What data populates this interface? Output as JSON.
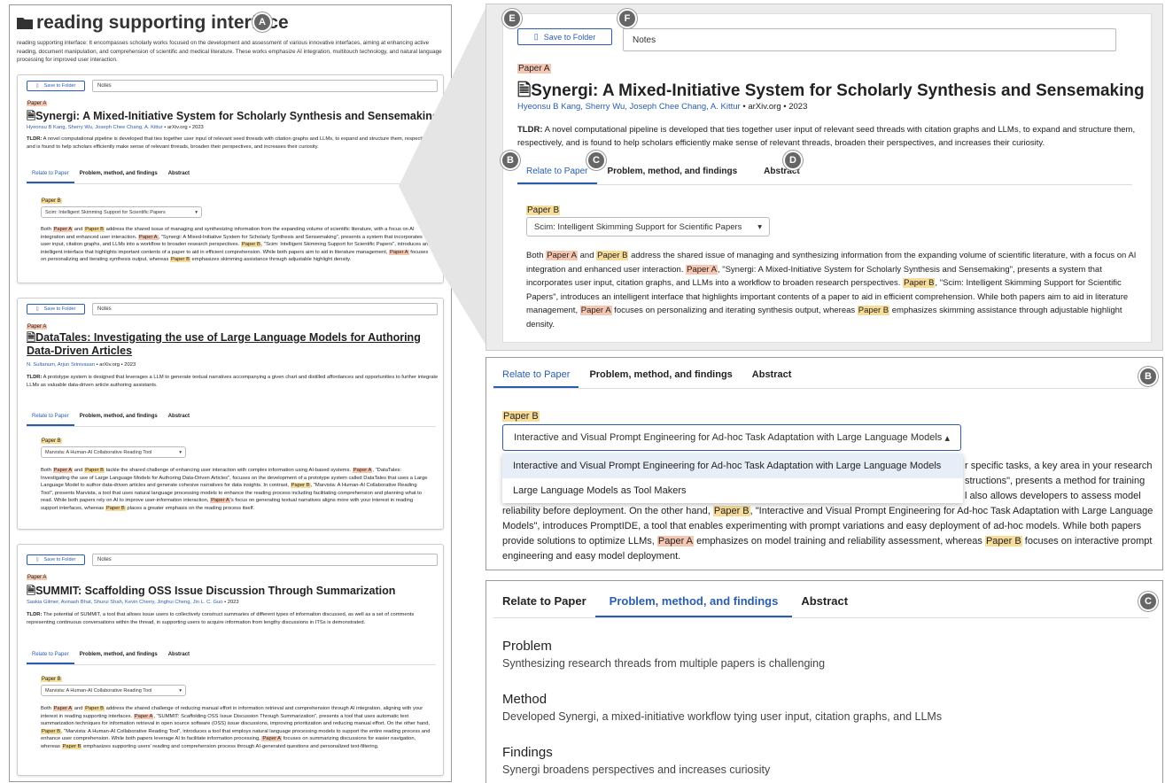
{
  "left": {
    "title": "reading supporting interface",
    "description": "reading supporting interface: It encompasses scholarly works focused on the development and assessment of various innovative interfaces, aiming at enhancing active reading, document manipulation, and comprehension of scientific and medical literature. These works emphasize AI integration, multitouch technology, and natural language processing for improved user interaction.",
    "save_label": "Save to Folder",
    "notes_label": "Notes",
    "paper_a_tag": "Paper A",
    "paper_b_tag": "Paper B",
    "tabs": [
      "Relate to Paper",
      "Problem, method, and findings",
      "Abstract"
    ],
    "cards": [
      {
        "title": "Synergi: A Mixed-Initiative System for Scholarly Synthesis and Sensemaking",
        "authors": "Hyeonsu B Kang, Sherry Wu, Joseph Chee Chang, A. Kittur",
        "venue": " • arXiv.org • 2023",
        "tldr_label": "TLDR:",
        "tldr": " A novel computational pipeline is developed that ties together user input of relevant seed threads with citation graphs and LLMs, to expand and structure them, respectively, and is found to help scholars efficiently make sense of relevant threads, broaden their perspectives, and increases their curiosity.",
        "select": "Scim: Intelligent Skimming Support for Scientific Papers"
      },
      {
        "title": "DataTales: Investigating the use of Large Language Models for Authoring Data-Driven Articles",
        "authors": "N. Sultanum, Arjun Srinivasan",
        "venue": " • arXiv.org • 2023",
        "tldr_label": "TLDR:",
        "tldr": " A prototype system is designed that leverages a LLM to generate textual narratives accompanying a given chart and distilled affordances and opportunities to further integrate LLMs as valuable data-driven article authoring assistants.",
        "select": "Marvista: A Human-AI Collaborative Reading Tool"
      },
      {
        "title": "SUMMIT: Scaffolding OSS Issue Discussion Through Summarization",
        "authors": "Saskia Gilmer, Avinash Bhat, Shurui Shah, Kevin Cherry, Jinghui Cheng, Jin L. C. Guo",
        "venue": " • 2023",
        "tldr_label": "TLDR:",
        "tldr": " The potential of SUMMIT, a tool that allows issue users to collectively construct summaries of different types of information discussed, as well as a set of comments representing continuous conversations within the thread, in supporting users to acquire information from lengthy discussions in ITSs is demonstrated.",
        "select": "Marvista: A Human-AI Collaborative Reading Tool"
      }
    ],
    "card1_relation": {
      "p1": "Both ",
      "p2": " and ",
      "p3": " address the shared issue of managing and synthesizing information from the expanding volume of scientific literature, with a focus on AI integration and enhanced user interaction. ",
      "p4": ", \"Synergi: A Mixed-Initiative System for Scholarly Synthesis and Sensemaking\", presents a system that incorporates user input, citation graphs, and LLMs into a workflow to broaden research perspectives. ",
      "p5": ", \"Scim: Intelligent Skimming Support for Scientific Papers\", introduces an intelligent interface that highlights important contents of a paper to aid in efficient comprehension. While both papers aim to aid in literature management, ",
      "p6": " focuses on personalizing and iterating synthesis output, whereas ",
      "p7": " emphasizes skimming assistance through adjustable highlight density."
    },
    "card2_relation": {
      "p1": "Both ",
      "p2": " and ",
      "p3": " tackle the shared challenge of enhancing user interaction with complex information using AI-based systems. ",
      "p4": ", \"DataTales: Investigating the use of Large Language Models for Authoring Data-Driven Articles\", focuses on the development of a prototype system called DataTales that uses a Large Language Model to author data-driven articles and generate cohesive narratives for data insights. In contrast, ",
      "p5": ", \"Marvista: A Human-AI Collaborative Reading Tool\", presents Marvista, a tool that uses natural language processing models to enhance the reading process including facilitating comprehension and planning what to read. While both papers rely on AI to improve user-information interaction, ",
      "p6": "'s focus on generating textual narratives aligns more with your interest in reading support interfaces, whereas ",
      "p7": " places a greater emphasis on the reading process itself."
    },
    "card3_relation": {
      "p1": "Both ",
      "p2": " and ",
      "p3": " address the shared challenge of reducing manual effort in information retrieval and comprehension through AI integration, aligning with your interest in reading supporting interfaces. ",
      "p4": ", \"SUMMIT: Scaffolding OSS Issue Discussion Through Summarization\", presents a tool that uses automatic text summarization techniques for information retrieval in open source software (OSS) issue discussions, improving prioritization and reducing manual effort. On the other hand, ",
      "p5": ", \"Marvista: A Human-AI Collaborative Reading Tool\", introduces a tool that employs natural language processing models to support the entire reading process and enhance user comprehension. While both papers leverage AI to facilitate information processing, ",
      "p6": " focuses on summarizing discussions for easier navigation, whereas ",
      "p7": " emphasizes supporting users' reading and comprehension process through AI-generated questions and personalized text-filtering."
    }
  },
  "zoom": {
    "save_label": "Save to Folder",
    "notes_label": "Notes",
    "paper_a_tag": "Paper A",
    "paper_b_tag": "Paper B",
    "title": "Synergi: A Mixed-Initiative System for Scholarly Synthesis and Sensemaking",
    "authors": "Hyeonsu B Kang, Sherry Wu, Joseph Chee Chang, A. Kittur",
    "venue": " • arXiv.org • 2023",
    "tldr_label": "TLDR:",
    "tldr": " A novel computational pipeline is developed that ties together user input of relevant seed threads with citation graphs and LLMs, to expand and structure them, respectively, and is found to help scholars efficiently make sense of relevant threads, broaden their perspectives, and increases their curiosity.",
    "tabs": [
      "Relate to Paper",
      "Problem, method, and findings",
      "Abstract"
    ],
    "select": "Scim: Intelligent Skimming Support for Scientific Papers"
  },
  "panelB": {
    "tabs": [
      "Relate to Paper",
      "Problem, method, and findings",
      "Abstract"
    ],
    "paper_b_tag": "Paper B",
    "select": "Interactive and Visual Prompt Engineering for Ad-hoc Task Adaptation with Large Language Models",
    "options": [
      "Interactive and Visual Prompt Engineering for Ad-hoc Task Adaptation with Large Language Models",
      "Large Language Models as Tool Makers"
    ],
    "line1_tail": "r specific tasks, a key area in your research",
    "line2_tail": "structions\", presents a method for training",
    "line3_tail": "l also allows developers to assess model",
    "p1": "reliability before deployment. On the other hand, ",
    "p2": ", \"Interactive and Visual Prompt Engineering for Ad-hoc Task Adaptation with Large Language Models\", introduces PromptIDE, a tool that enables experimenting with prompt variations and easy deployment of ad-hoc models. While both papers provide solutions to optimize LLMs, ",
    "p3": " emphasizes on model training and reliability assessment, whereas ",
    "p4": " focuses on interactive prompt engineering and easy model deployment."
  },
  "panelC": {
    "tabs": [
      "Relate to Paper",
      "Problem, method, and findings",
      "Abstract"
    ],
    "problem_h": "Problem",
    "problem": "Synthesizing research threads from multiple papers is challenging",
    "method_h": "Method",
    "method": "Developed Synergi, a mixed-initiative workflow tying user input, citation graphs, and LLMs",
    "findings_h": "Findings",
    "findings": "Synergi broadens perspectives and increases curiosity"
  },
  "markers": [
    "A",
    "B",
    "C",
    "D",
    "E",
    "F"
  ]
}
